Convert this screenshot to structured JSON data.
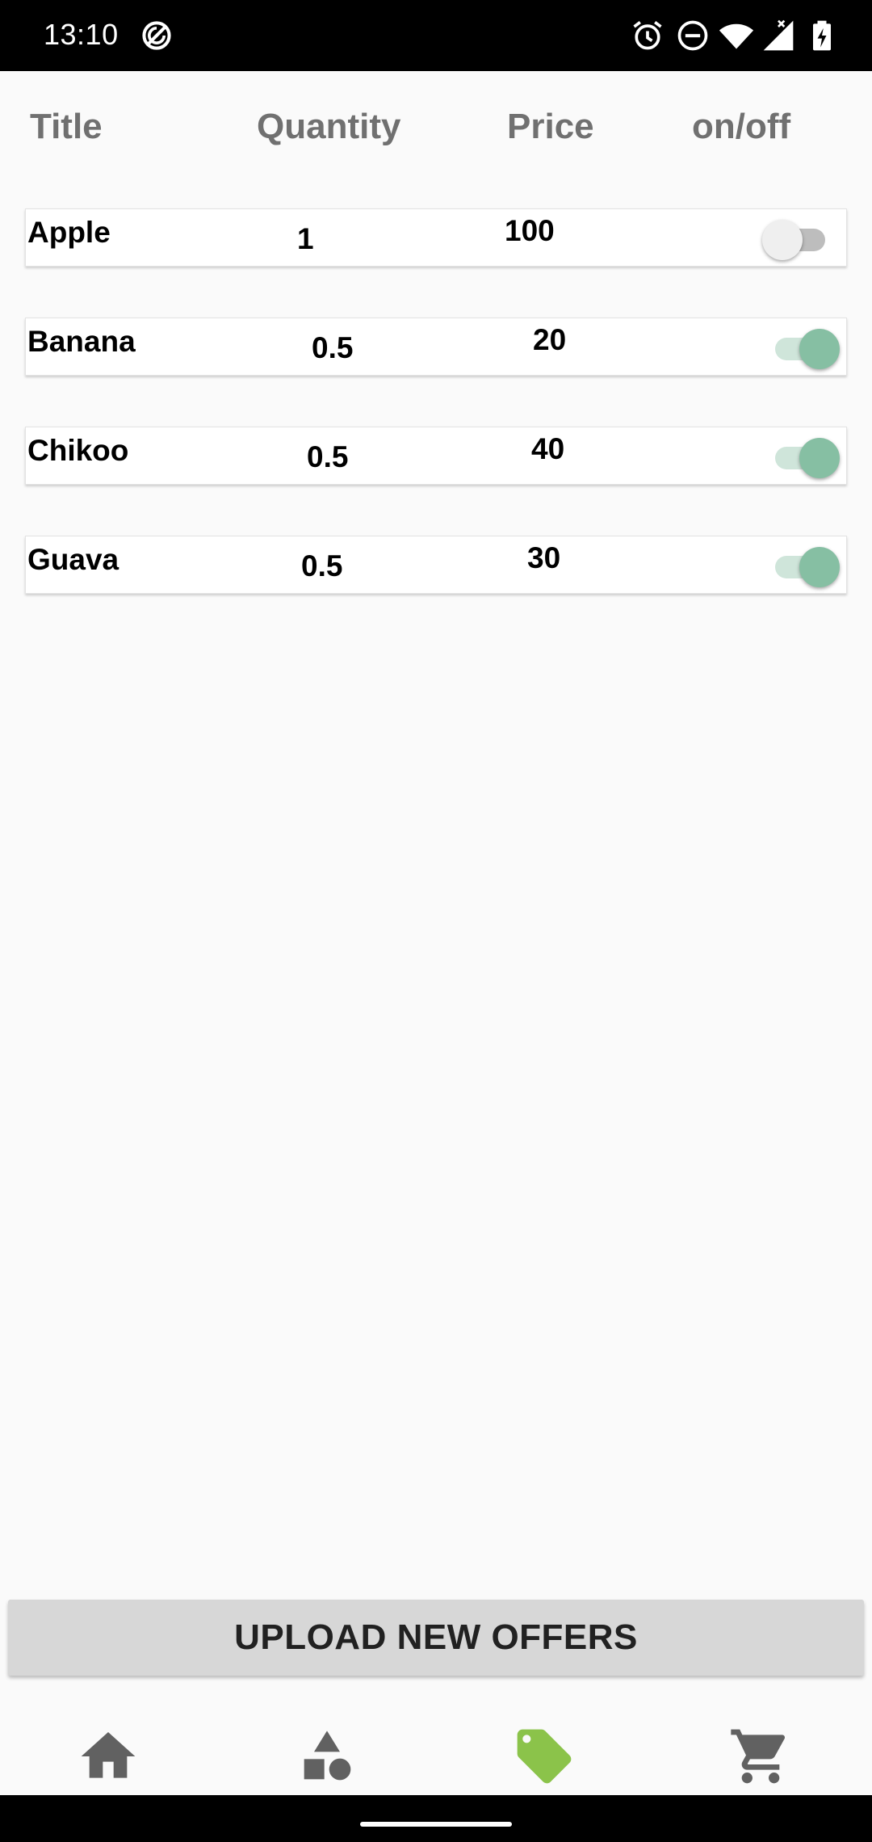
{
  "status_bar": {
    "time": "13:10",
    "icons": [
      "sync-disabled-icon",
      "alarm-icon",
      "do-not-disturb-icon",
      "wifi-icon",
      "cellular-no-signal-icon",
      "battery-charging-icon"
    ]
  },
  "table": {
    "headers": {
      "title": "Title",
      "quantity": "Quantity",
      "price": "Price",
      "on_off": "on/off"
    },
    "rows": [
      {
        "title": "Apple",
        "quantity": "1",
        "price": "100",
        "enabled": false
      },
      {
        "title": "Banana",
        "quantity": "0.5",
        "price": "20",
        "enabled": true
      },
      {
        "title": "Chikoo",
        "quantity": "0.5",
        "price": "40",
        "enabled": true
      },
      {
        "title": "Guava",
        "quantity": "0.5",
        "price": "30",
        "enabled": true
      }
    ]
  },
  "upload_button": {
    "label": "UPLOAD NEW OFFERS"
  },
  "bottom_nav": {
    "items": [
      {
        "icon": "home-icon",
        "active": false
      },
      {
        "icon": "categories-icon",
        "active": false
      },
      {
        "icon": "offers-tag-icon",
        "active": true
      },
      {
        "icon": "cart-icon",
        "active": false
      }
    ],
    "active_color": "#8bc34a",
    "inactive_color": "#616161"
  },
  "colors": {
    "switch_on_thumb": "#86bfa3",
    "switch_on_track": "#cfe5da",
    "switch_off_thumb": "#efefef",
    "switch_off_track": "#bdbdbd"
  }
}
